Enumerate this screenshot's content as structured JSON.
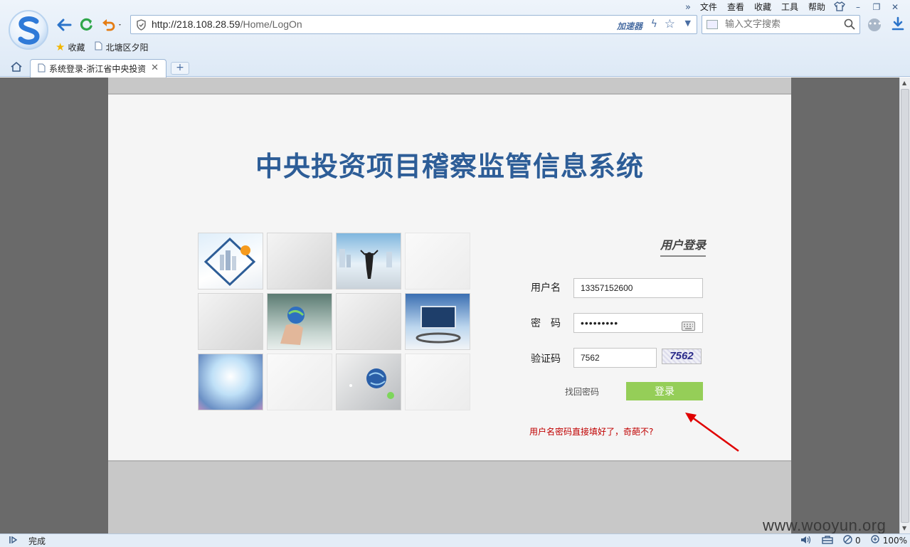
{
  "browser": {
    "menus": [
      "文件",
      "查看",
      "收藏",
      "工具",
      "帮助"
    ],
    "address": {
      "host": "http://218.108.28.59",
      "path": "/Home/LogOn",
      "accelerator": "加速器"
    },
    "search": {
      "placeholder": "输入文字搜索"
    },
    "bookmarks": [
      {
        "label": "收藏",
        "icon": "star-icon"
      },
      {
        "label": "北塘区夕阳",
        "icon": "page-icon"
      }
    ],
    "tab": {
      "title": "系统登录-浙江省中央投资"
    },
    "status": {
      "text": "完成",
      "zoom": "100%",
      "count": "0"
    },
    "colors": {
      "accent": "#2d5d97",
      "chrome": "#dde9f6"
    }
  },
  "page": {
    "title": "中央投资项目稽察监管信息系统",
    "login": {
      "heading": "用户登录",
      "username_label": "用户名",
      "username_value": "13357152600",
      "password_label": "密　码",
      "password_value": "•••••••••",
      "captcha_label": "验证码",
      "captcha_value": "7562",
      "captcha_image_text": "7562",
      "forgot_label": "找回密码",
      "submit_label": "登录",
      "button_color": "#95ce58"
    },
    "annotation": "用户名密码直接填好了，奇葩不?"
  },
  "watermark": "www.wooyun.org"
}
